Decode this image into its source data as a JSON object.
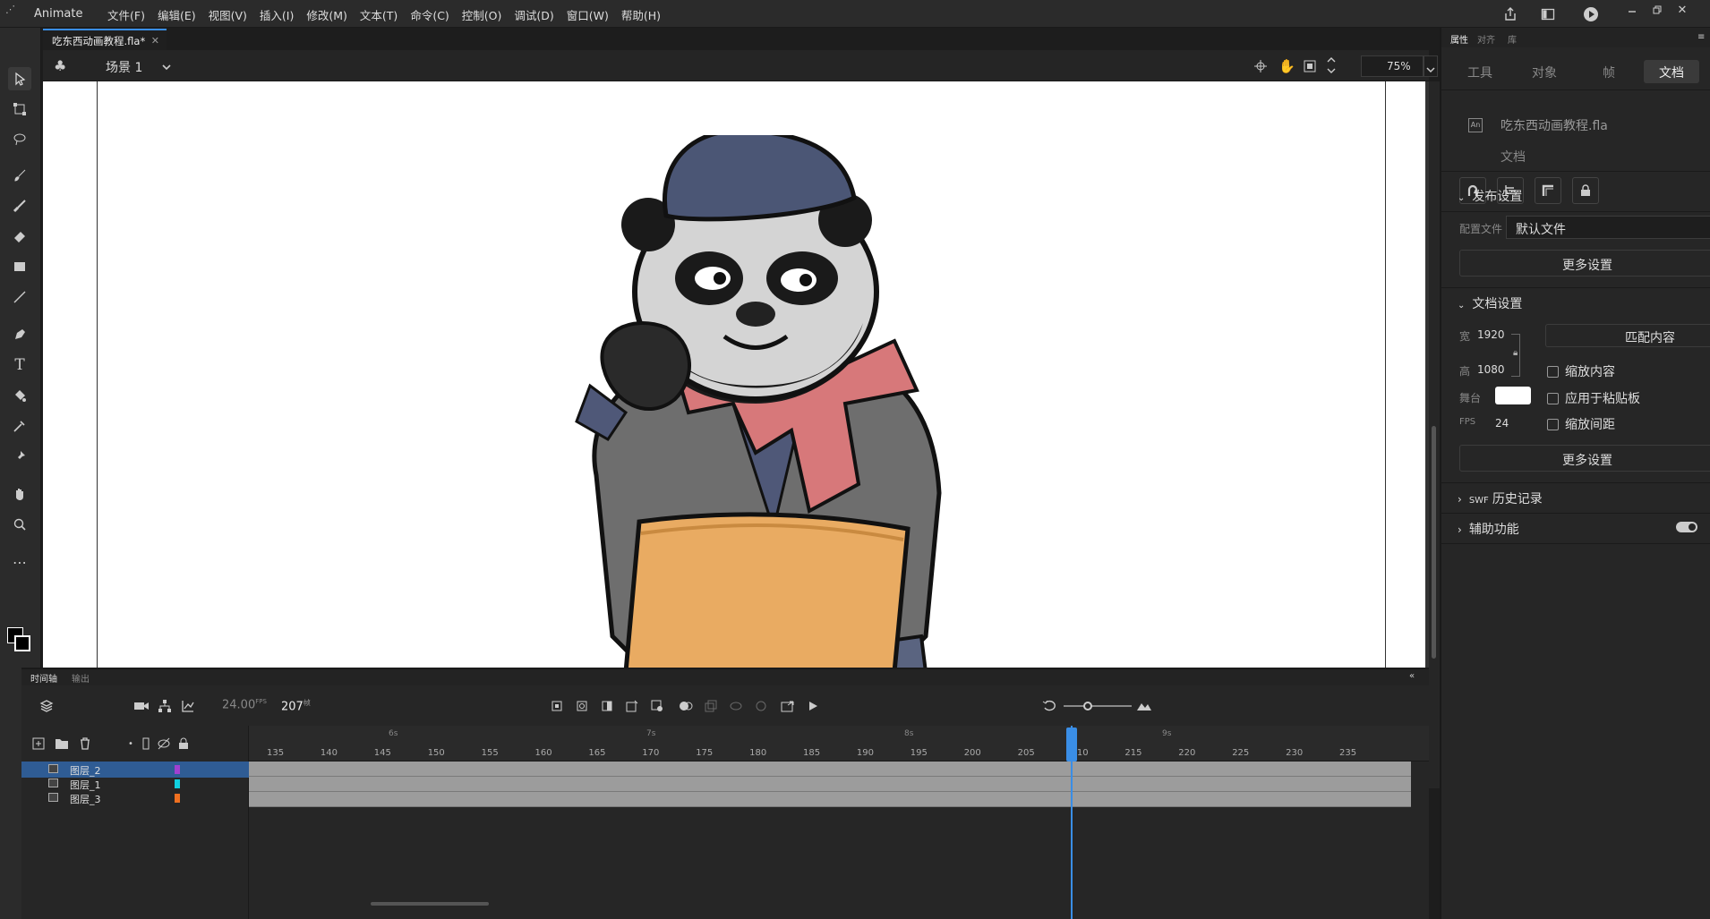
{
  "menubar": {
    "app_name": "Animate",
    "items": [
      "文件(F)",
      "编辑(E)",
      "视图(V)",
      "插入(I)",
      "修改(M)",
      "文本(T)",
      "命令(C)",
      "控制(O)",
      "调试(D)",
      "窗口(W)",
      "帮助(H)"
    ]
  },
  "document": {
    "tab_title": "吃东西动画教程.fla*",
    "scene": "场景 1",
    "zoom": "75%"
  },
  "timeline": {
    "tabs": [
      "时间轴",
      "输出"
    ],
    "fps": "24.00",
    "fps_unit": "FPS",
    "current_frame": "207",
    "frame_unit": "帧",
    "second_markers": [
      "6s",
      "7s",
      "8s",
      "9s"
    ],
    "ruler_ticks": [
      "135",
      "140",
      "145",
      "150",
      "155",
      "160",
      "165",
      "170",
      "175",
      "180",
      "185",
      "190",
      "195",
      "200",
      "205",
      "210",
      "215",
      "220",
      "225",
      "230",
      "235"
    ],
    "layers": [
      {
        "name": "图层_2",
        "color": "#a040d0",
        "selected": true
      },
      {
        "name": "图层_1",
        "color": "#10d0e0",
        "selected": false
      },
      {
        "name": "图层_3",
        "color": "#f07020",
        "selected": false
      }
    ]
  },
  "properties": {
    "panel_tabs": [
      "属性",
      "对齐",
      "库"
    ],
    "sub_tabs": [
      "工具",
      "对象",
      "帧",
      "文档"
    ],
    "active_sub_tab": "文档",
    "file_name": "吃东西动画教程.fla",
    "file_type": "文档",
    "publish_settings": {
      "title": "发布设置",
      "profile_label": "配置文件",
      "profile_value": "默认文件",
      "more_button": "更多设置"
    },
    "document_settings": {
      "title": "文档设置",
      "width_label": "宽",
      "width_value": "1920",
      "height_label": "高",
      "height_value": "1080",
      "stage_label": "舞台",
      "stage_color": "#ffffff",
      "fps_label": "FPS",
      "fps_value": "24",
      "match_button": "匹配内容",
      "scale_content": "缩放内容",
      "apply_pasteboard": "应用于粘贴板",
      "scale_spacing": "缩放间距",
      "more_button": "更多设置"
    },
    "swf_history": {
      "prefix": "SWF",
      "title": "历史记录"
    },
    "accessibility": "辅助功能"
  }
}
